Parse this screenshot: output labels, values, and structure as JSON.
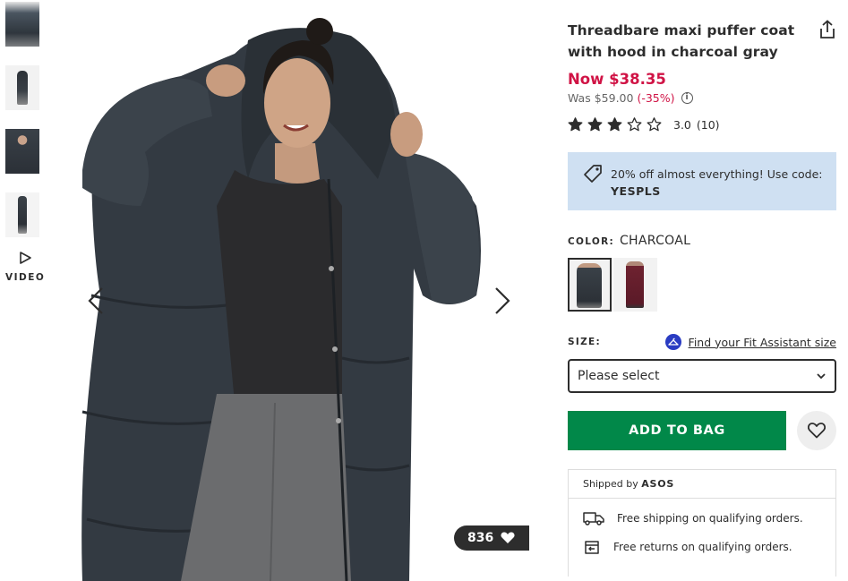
{
  "gallery": {
    "thumbnails": [
      "thumbnail-1",
      "thumbnail-2",
      "thumbnail-3",
      "thumbnail-4"
    ],
    "video_label": "VIDEO",
    "likes_count": "836"
  },
  "product": {
    "title": "Threadbare maxi puffer coat with hood in charcoal gray",
    "price_now": "Now $38.35",
    "price_was": "Was $59.00",
    "discount": "(-35%)",
    "rating": {
      "stars_filled": 3,
      "stars_total": 5,
      "score": "3.0",
      "count": "(10)"
    }
  },
  "promo": {
    "text": "20% off almost everything! Use code:",
    "code": "YESPLS",
    "color": "#cfe0f2"
  },
  "color": {
    "label": "COLOR:",
    "value": "CHARCOAL",
    "swatches": [
      "charcoal",
      "burgundy"
    ]
  },
  "size": {
    "label": "SIZE:",
    "fit_link": "Find your Fit Assistant size",
    "select_placeholder": "Please select"
  },
  "actions": {
    "add_to_bag": "ADD TO BAG",
    "primary_color": "#018849"
  },
  "shipping": {
    "shipped_by_prefix": "Shipped by",
    "shipped_by_brand": "ASOS",
    "free_shipping": "Free shipping on qualifying orders.",
    "free_returns": "Free returns on qualifying orders."
  },
  "colors": {
    "sale": "#d01345",
    "text": "#2d2d2d"
  }
}
